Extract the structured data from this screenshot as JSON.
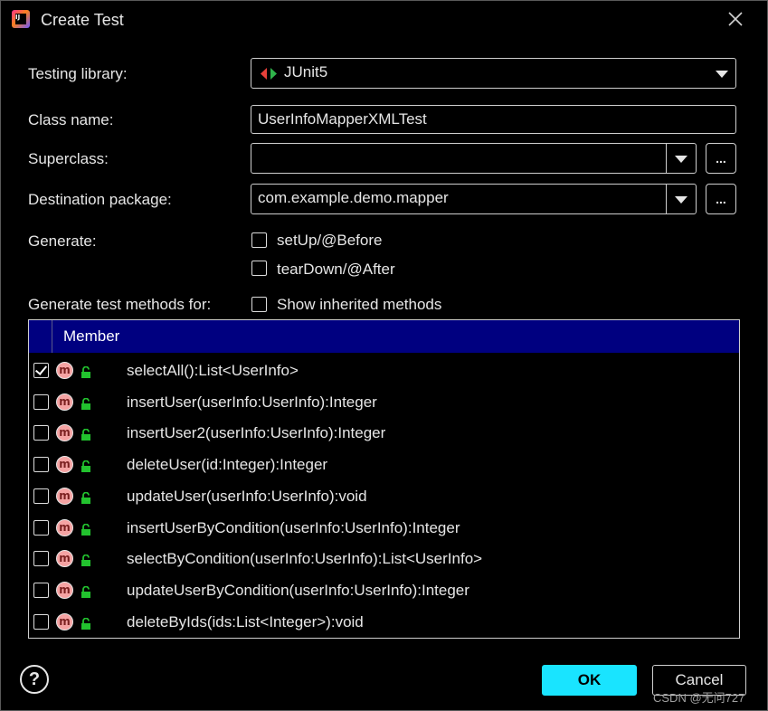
{
  "window": {
    "title": "Create Test",
    "app_icon_text": "IJ"
  },
  "form": {
    "testing_library": {
      "label": "Testing library:",
      "value": "JUnit5",
      "icon": "junit-icon"
    },
    "class_name": {
      "label": "Class name:",
      "value": "UserInfoMapperXMLTest"
    },
    "superclass": {
      "label": "Superclass:",
      "value": "",
      "browse_label": "..."
    },
    "destination_package": {
      "label": "Destination package:",
      "value": "com.example.demo.mapper",
      "browse_label": "..."
    },
    "generate": {
      "label": "Generate:",
      "options": [
        {
          "label": "setUp/@Before",
          "checked": false
        },
        {
          "label": "tearDown/@After",
          "checked": false
        }
      ]
    },
    "methods_for": {
      "label": "Generate test methods for:",
      "show_inherited_label": "Show inherited methods",
      "show_inherited_checked": false
    }
  },
  "table": {
    "column_header": "Member",
    "header_color": "#000080",
    "rows": [
      {
        "signature": "selectAll():List<UserInfo>",
        "checked": true
      },
      {
        "signature": "insertUser(userInfo:UserInfo):Integer",
        "checked": false
      },
      {
        "signature": "insertUser2(userInfo:UserInfo):Integer",
        "checked": false
      },
      {
        "signature": "deleteUser(id:Integer):Integer",
        "checked": false
      },
      {
        "signature": "updateUser(userInfo:UserInfo):void",
        "checked": false
      },
      {
        "signature": "insertUserByCondition(userInfo:UserInfo):Integer",
        "checked": false
      },
      {
        "signature": "selectByCondition(userInfo:UserInfo):List<UserInfo>",
        "checked": false
      },
      {
        "signature": "updateUserByCondition(userInfo:UserInfo):Integer",
        "checked": false
      },
      {
        "signature": "deleteByIds(ids:List<Integer>):void",
        "checked": false
      }
    ],
    "method_icon_letter": "m"
  },
  "buttons": {
    "help": "?",
    "ok": "OK",
    "cancel": "Cancel",
    "ok_color": "#19e4ff"
  },
  "watermark": "CSDN @无问727"
}
